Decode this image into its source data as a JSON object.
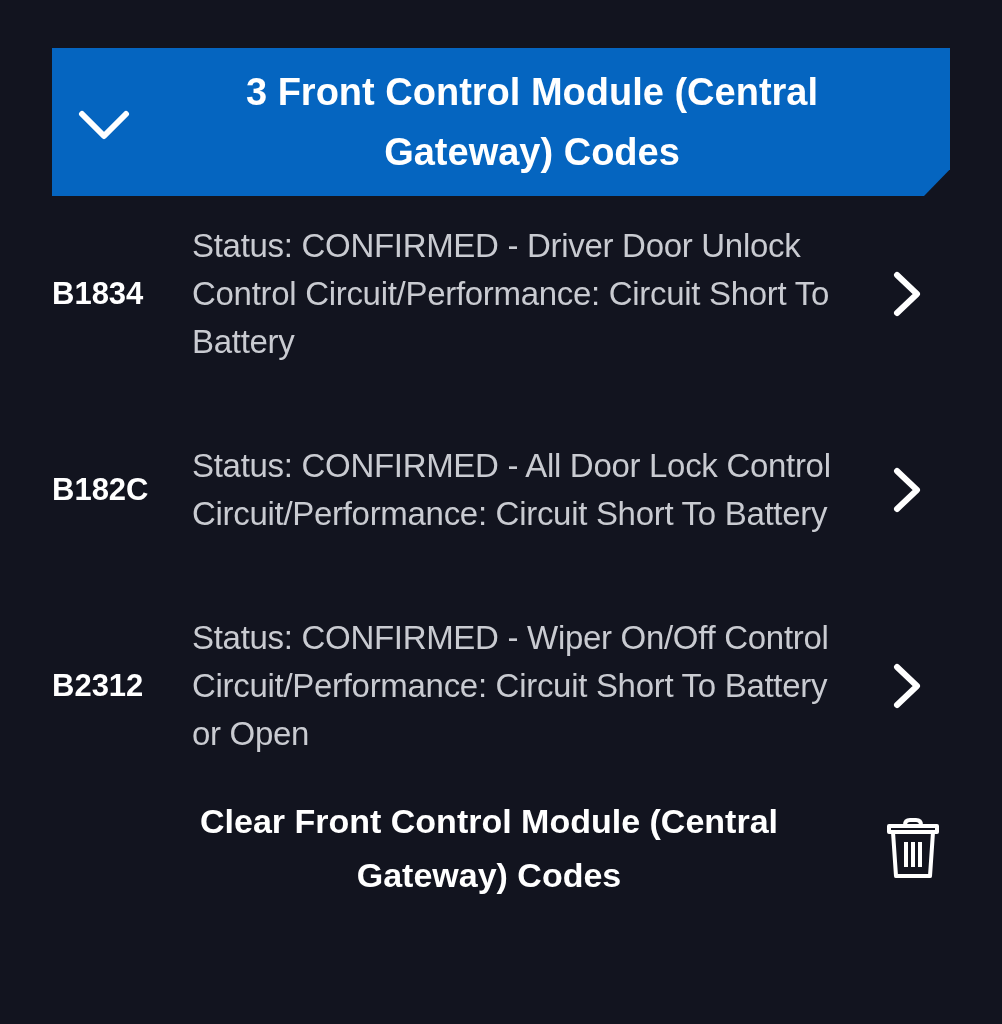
{
  "section": {
    "title": "3 Front Control Module (Central Gateway) Codes",
    "expanded": true
  },
  "codes": [
    {
      "code": "B1834",
      "description": "Status: CONFIRMED - Driver Door Unlock Control Circuit/Performance: Circuit Short To Battery"
    },
    {
      "code": "B182C",
      "description": "Status: CONFIRMED - All Door Lock Control Circuit/Performance: Circuit Short To Battery"
    },
    {
      "code": "B2312",
      "description": "Status: CONFIRMED - Wiper On/Off Control Circuit/Performance: Circuit Short To Battery or Open"
    }
  ],
  "clear_action": {
    "label": "Clear Front Control Module (Central Gateway) Codes"
  }
}
